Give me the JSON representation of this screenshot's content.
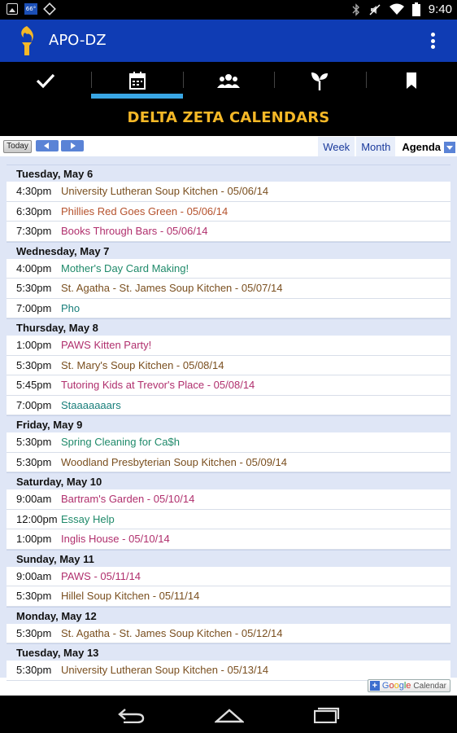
{
  "status_bar": {
    "badge": "66°",
    "time": "9:40"
  },
  "app_bar": {
    "title": "APO-DZ"
  },
  "tabs": [
    {
      "icon": "checkmark-icon",
      "active": false
    },
    {
      "icon": "calendar-icon",
      "active": true
    },
    {
      "icon": "people-icon",
      "active": false
    },
    {
      "icon": "sprout-icon",
      "active": false
    },
    {
      "icon": "bookmark-icon",
      "active": false
    }
  ],
  "header": {
    "title": "DELTA ZETA CALENDARS"
  },
  "toolbar": {
    "today_label": "Today",
    "views": [
      "Week",
      "Month",
      "Agenda"
    ],
    "selected_view": "Agenda"
  },
  "agenda": [
    {
      "day": "Tuesday, May 6",
      "events": [
        {
          "time": "4:30pm",
          "title": "University Lutheran Soup Kitchen - 05/06/14",
          "color": "brown"
        },
        {
          "time": "6:30pm",
          "title": "Phillies Red Goes Green - 05/06/14",
          "color": "orange"
        },
        {
          "time": "7:30pm",
          "title": "Books Through Bars - 05/06/14",
          "color": "pink"
        }
      ]
    },
    {
      "day": "Wednesday, May 7",
      "events": [
        {
          "time": "4:00pm",
          "title": "Mother's Day Card Making!",
          "color": "green"
        },
        {
          "time": "5:30pm",
          "title": "St. Agatha - St. James Soup Kitchen - 05/07/14",
          "color": "brown"
        },
        {
          "time": "7:00pm",
          "title": "Pho",
          "color": "teal"
        }
      ]
    },
    {
      "day": "Thursday, May 8",
      "events": [
        {
          "time": "1:00pm",
          "title": "PAWS Kitten Party!",
          "color": "pink"
        },
        {
          "time": "5:30pm",
          "title": "St. Mary's Soup Kitchen - 05/08/14",
          "color": "brown"
        },
        {
          "time": "5:45pm",
          "title": "Tutoring Kids at Trevor's Place - 05/08/14",
          "color": "pink"
        },
        {
          "time": "7:00pm",
          "title": "Staaaaaaars",
          "color": "teal"
        }
      ]
    },
    {
      "day": "Friday, May 9",
      "events": [
        {
          "time": "5:30pm",
          "title": "Spring Cleaning for Ca$h",
          "color": "green"
        },
        {
          "time": "5:30pm",
          "title": "Woodland Presbyterian Soup Kitchen - 05/09/14",
          "color": "brown"
        }
      ]
    },
    {
      "day": "Saturday, May 10",
      "events": [
        {
          "time": "9:00am",
          "title": "Bartram's Garden - 05/10/14",
          "color": "pink"
        },
        {
          "time": "12:00pm",
          "title": "Essay Help",
          "color": "green"
        },
        {
          "time": "1:00pm",
          "title": "Inglis House - 05/10/14",
          "color": "pink"
        }
      ]
    },
    {
      "day": "Sunday, May 11",
      "events": [
        {
          "time": "9:00am",
          "title": "PAWS - 05/11/14",
          "color": "pink"
        },
        {
          "time": "5:30pm",
          "title": "Hillel Soup Kitchen - 05/11/14",
          "color": "brown"
        }
      ]
    },
    {
      "day": "Monday, May 12",
      "events": [
        {
          "time": "5:30pm",
          "title": "St. Agatha - St. James Soup Kitchen - 05/12/14",
          "color": "brown"
        }
      ]
    },
    {
      "day": "Tuesday, May 13",
      "events": [
        {
          "time": "5:30pm",
          "title": "University Lutheran Soup Kitchen - 05/13/14",
          "color": "brown"
        }
      ]
    }
  ],
  "footer": {
    "gcal_plus": "+",
    "gcal_brand": "Google",
    "gcal_label": "Calendar"
  },
  "colors": {
    "app_bar": "#0f3cb4",
    "header_text": "#f5b827",
    "tab_indicator": "#39a6e4"
  }
}
